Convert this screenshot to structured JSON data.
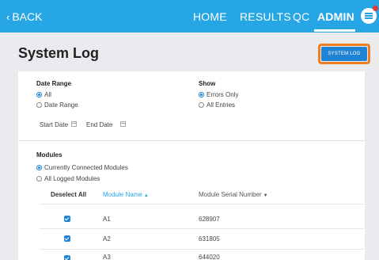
{
  "topbar": {
    "back_label": "BACK",
    "nav": [
      "HOME",
      "RESULTS",
      "QC",
      "ADMIN"
    ],
    "active_nav": "ADMIN",
    "accent_color": "#26a6e4",
    "notification_color": "#e53935",
    "menu_icon": "hamburger-menu-icon"
  },
  "page": {
    "title": "System Log",
    "system_log_button": "SYSTEM LOG",
    "highlight_color": "#f07d1e"
  },
  "filters": {
    "date_range_label": "Date Range",
    "date_options": [
      "All",
      "Date Range"
    ],
    "date_selected": "All",
    "show_label": "Show",
    "show_options": [
      "Errors Only",
      "All Entries"
    ],
    "show_selected": "Errors Only",
    "start_date_label": "Start Date",
    "end_date_label": "End Date"
  },
  "modules": {
    "label": "Modules",
    "options": [
      "Currently Connected Modules",
      "All Logged Modules"
    ],
    "selected": "Currently Connected Modules",
    "deselect_all": "Deselect All",
    "col_name": "Module Name",
    "col_serial": "Module Serial Number",
    "rows": [
      {
        "name": "A1",
        "serial": "628907",
        "checked": true
      },
      {
        "name": "A2",
        "serial": "631805",
        "checked": true
      },
      {
        "name": "A3",
        "serial": "644020",
        "checked": true
      }
    ]
  }
}
